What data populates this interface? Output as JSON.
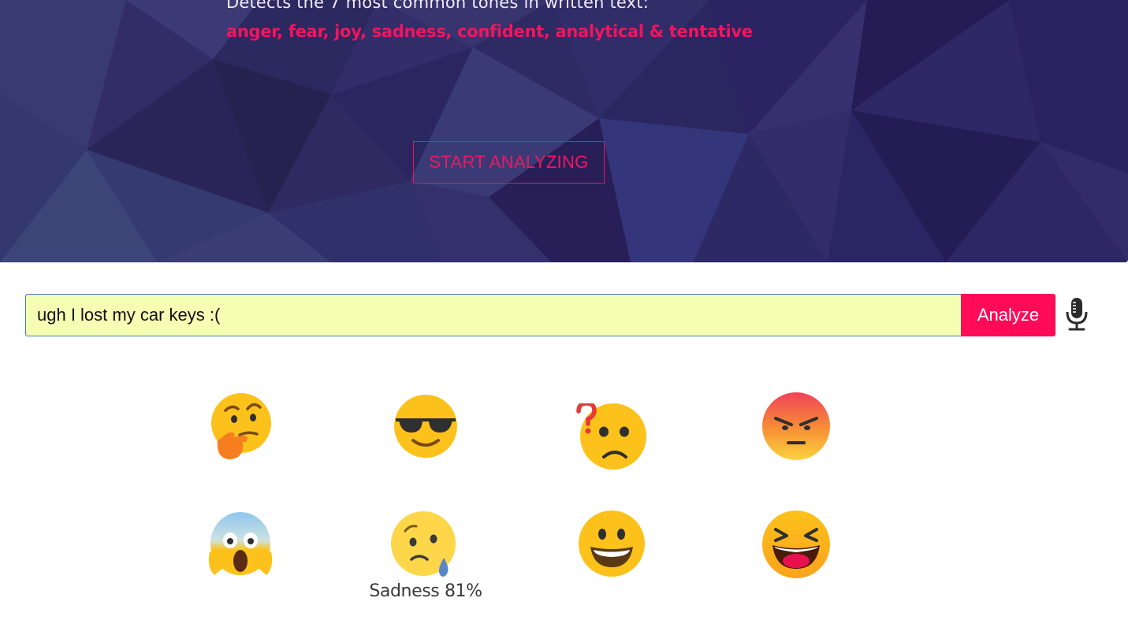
{
  "hero": {
    "description": "Detects the 7 most common tones in written text:",
    "tones_list": "anger, fear, joy, sadness, confident, analytical & tentative",
    "start_button": "START ANALYZING",
    "accent_color": "#f4145e",
    "background_color": "#2e2a63"
  },
  "analyzer": {
    "input_value": "ugh I lost my car keys :(",
    "analyze_button": "Analyze",
    "input_background": "#f5ffb4",
    "button_color": "#ff0b57",
    "mic_icon": "microphone-icon"
  },
  "emojis": [
    {
      "icon": "thinking-face-icon",
      "tone": "analytical"
    },
    {
      "icon": "sunglasses-face-icon",
      "tone": "confident"
    },
    {
      "icon": "confused-question-face-icon",
      "tone": "tentative"
    },
    {
      "icon": "angry-face-icon",
      "tone": "anger"
    },
    {
      "icon": "screaming-fear-face-icon",
      "tone": "fear"
    },
    {
      "icon": "sad-tear-face-icon",
      "tone": "sadness"
    },
    {
      "icon": "grinning-face-icon",
      "tone": "joy"
    },
    {
      "icon": "laughing-squint-face-icon",
      "tone": "joy"
    }
  ],
  "result": {
    "label": "Sadness 81%",
    "tone": "sadness",
    "score_percent": 81
  }
}
